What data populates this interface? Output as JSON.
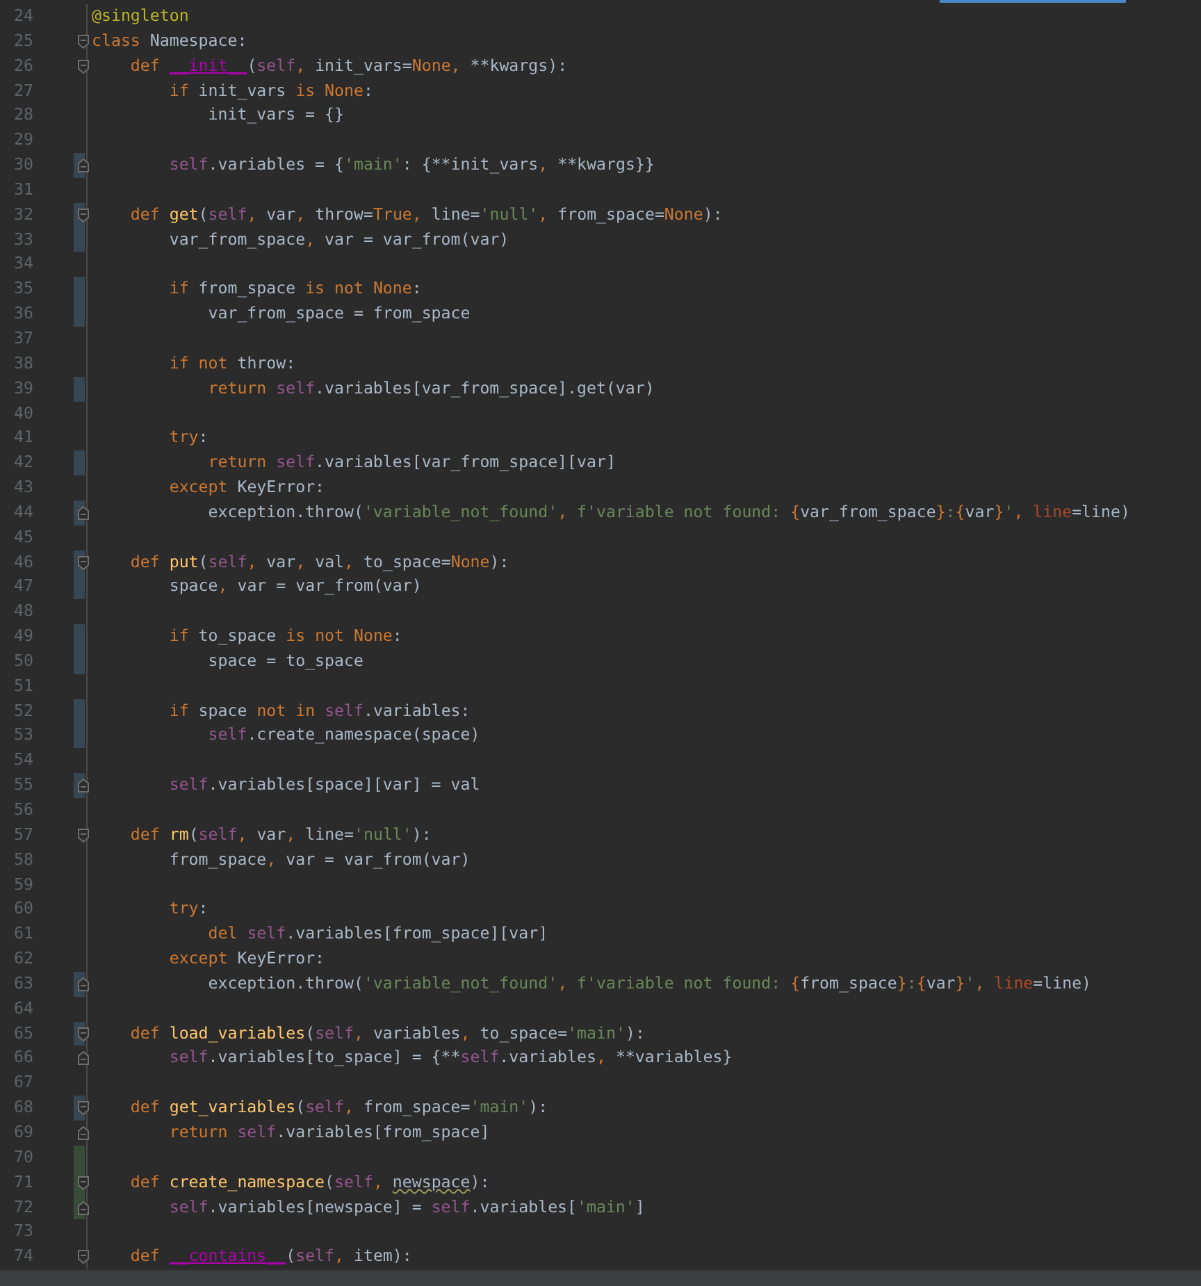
{
  "editor": {
    "lines": [
      {
        "number": "24",
        "fold_start": false,
        "fold_end": false,
        "modified": false,
        "added": false,
        "tokens": [
          {
            "kind": "decorator",
            "text": "@singleton"
          }
        ]
      },
      {
        "number": "25",
        "fold_start": true,
        "fold_end": false,
        "modified": false,
        "added": false,
        "tokens": [
          {
            "kind": "keyword",
            "text": "class"
          },
          {
            "kind": "plain",
            "text": " Namespace:"
          }
        ]
      },
      {
        "number": "26",
        "fold_start": true,
        "fold_end": false,
        "modified": false,
        "added": false,
        "tokens": [
          {
            "kind": "keyword",
            "text": "    def "
          },
          {
            "kind": "magic",
            "text": "__init__"
          },
          {
            "kind": "plain",
            "text": "("
          },
          {
            "kind": "self",
            "text": "self"
          },
          {
            "kind": "keyword",
            "text": ", "
          },
          {
            "kind": "plain",
            "text": "init_vars="
          },
          {
            "kind": "keyword",
            "text": "None"
          },
          {
            "kind": "keyword",
            "text": ", "
          },
          {
            "kind": "plain",
            "text": "**kwargs):"
          }
        ]
      },
      {
        "number": "27",
        "fold_start": false,
        "fold_end": false,
        "modified": false,
        "added": false,
        "tokens": [
          {
            "kind": "keyword",
            "text": "        if"
          },
          {
            "kind": "plain",
            "text": " init_vars "
          },
          {
            "kind": "keyword",
            "text": "is None"
          },
          {
            "kind": "plain",
            "text": ":"
          }
        ]
      },
      {
        "number": "28",
        "fold_start": false,
        "fold_end": false,
        "modified": false,
        "added": false,
        "tokens": [
          {
            "kind": "plain",
            "text": "            init_vars = {}"
          }
        ]
      },
      {
        "number": "29",
        "fold_start": false,
        "fold_end": false,
        "modified": false,
        "added": false
      },
      {
        "number": "30",
        "fold_start": false,
        "fold_end": true,
        "modified": true,
        "added": false,
        "tokens": [
          {
            "kind": "self",
            "text": "        self"
          },
          {
            "kind": "plain",
            "text": ".variables = {"
          },
          {
            "kind": "string",
            "text": "'main'"
          },
          {
            "kind": "plain",
            "text": ": {**init_vars"
          },
          {
            "kind": "keyword",
            "text": ", "
          },
          {
            "kind": "plain",
            "text": "**kwargs}}"
          }
        ]
      },
      {
        "number": "31",
        "fold_start": false,
        "fold_end": false,
        "modified": false,
        "added": false
      },
      {
        "number": "32",
        "fold_start": true,
        "fold_end": false,
        "modified": true,
        "added": false,
        "tokens": [
          {
            "kind": "keyword",
            "text": "    def "
          },
          {
            "kind": "function",
            "text": "get"
          },
          {
            "kind": "plain",
            "text": "("
          },
          {
            "kind": "self",
            "text": "self"
          },
          {
            "kind": "keyword",
            "text": ", "
          },
          {
            "kind": "plain",
            "text": "var"
          },
          {
            "kind": "keyword",
            "text": ", "
          },
          {
            "kind": "plain",
            "text": "throw="
          },
          {
            "kind": "keyword",
            "text": "True"
          },
          {
            "kind": "keyword",
            "text": ", "
          },
          {
            "kind": "plain",
            "text": "line="
          },
          {
            "kind": "string",
            "text": "'null'"
          },
          {
            "kind": "keyword",
            "text": ", "
          },
          {
            "kind": "plain",
            "text": "from_space="
          },
          {
            "kind": "keyword",
            "text": "None"
          },
          {
            "kind": "plain",
            "text": "):"
          }
        ]
      },
      {
        "number": "33",
        "fold_start": false,
        "fold_end": false,
        "modified": true,
        "added": false,
        "tokens": [
          {
            "kind": "plain",
            "text": "        var_from_space"
          },
          {
            "kind": "keyword",
            "text": ", "
          },
          {
            "kind": "plain",
            "text": "var = var_from(var)"
          }
        ]
      },
      {
        "number": "34",
        "fold_start": false,
        "fold_end": false,
        "modified": false,
        "added": false
      },
      {
        "number": "35",
        "fold_start": false,
        "fold_end": false,
        "modified": true,
        "added": false,
        "tokens": [
          {
            "kind": "keyword",
            "text": "        if"
          },
          {
            "kind": "plain",
            "text": " from_space "
          },
          {
            "kind": "keyword",
            "text": "is not None"
          },
          {
            "kind": "plain",
            "text": ":"
          }
        ]
      },
      {
        "number": "36",
        "fold_start": false,
        "fold_end": false,
        "modified": true,
        "added": false,
        "tokens": [
          {
            "kind": "plain",
            "text": "            var_from_space = from_space"
          }
        ]
      },
      {
        "number": "37",
        "fold_start": false,
        "fold_end": false,
        "modified": false,
        "added": false
      },
      {
        "number": "38",
        "fold_start": false,
        "fold_end": false,
        "modified": false,
        "added": false,
        "tokens": [
          {
            "kind": "keyword",
            "text": "        if not"
          },
          {
            "kind": "plain",
            "text": " throw:"
          }
        ]
      },
      {
        "number": "39",
        "fold_start": false,
        "fold_end": false,
        "modified": true,
        "added": false,
        "tokens": [
          {
            "kind": "keyword",
            "text": "            return "
          },
          {
            "kind": "self",
            "text": "self"
          },
          {
            "kind": "plain",
            "text": ".variables[var_from_space].get(var)"
          }
        ]
      },
      {
        "number": "40",
        "fold_start": false,
        "fold_end": false,
        "modified": false,
        "added": false
      },
      {
        "number": "41",
        "fold_start": false,
        "fold_end": false,
        "modified": false,
        "added": false,
        "tokens": [
          {
            "kind": "keyword",
            "text": "        try"
          },
          {
            "kind": "plain",
            "text": ":"
          }
        ]
      },
      {
        "number": "42",
        "fold_start": false,
        "fold_end": false,
        "modified": true,
        "added": false,
        "tokens": [
          {
            "kind": "keyword",
            "text": "            return "
          },
          {
            "kind": "self",
            "text": "self"
          },
          {
            "kind": "plain",
            "text": ".variables[var_from_space][var]"
          }
        ]
      },
      {
        "number": "43",
        "fold_start": false,
        "fold_end": false,
        "modified": false,
        "added": false,
        "tokens": [
          {
            "kind": "keyword",
            "text": "        except"
          },
          {
            "kind": "plain",
            "text": " KeyError:"
          }
        ]
      },
      {
        "number": "44",
        "fold_start": false,
        "fold_end": true,
        "modified": true,
        "added": false,
        "tokens": [
          {
            "kind": "plain",
            "text": "            exception.throw("
          },
          {
            "kind": "string",
            "text": "'variable_not_found'"
          },
          {
            "kind": "keyword",
            "text": ", "
          },
          {
            "kind": "string",
            "text": "f'variable not found: "
          },
          {
            "kind": "brace",
            "text": "{"
          },
          {
            "kind": "plain",
            "text": "var_from_space"
          },
          {
            "kind": "brace",
            "text": "}"
          },
          {
            "kind": "string",
            "text": ":"
          },
          {
            "kind": "brace",
            "text": "{"
          },
          {
            "kind": "plain",
            "text": "var"
          },
          {
            "kind": "brace",
            "text": "}"
          },
          {
            "kind": "string",
            "text": "'"
          },
          {
            "kind": "keyword",
            "text": ", "
          },
          {
            "kind": "kwarg",
            "text": "line"
          },
          {
            "kind": "plain",
            "text": "=line)"
          }
        ]
      },
      {
        "number": "45",
        "fold_start": false,
        "fold_end": false,
        "modified": false,
        "added": false
      },
      {
        "number": "46",
        "fold_start": true,
        "fold_end": false,
        "modified": true,
        "added": false,
        "tokens": [
          {
            "kind": "keyword",
            "text": "    def "
          },
          {
            "kind": "function",
            "text": "put"
          },
          {
            "kind": "plain",
            "text": "("
          },
          {
            "kind": "self",
            "text": "self"
          },
          {
            "kind": "keyword",
            "text": ", "
          },
          {
            "kind": "plain",
            "text": "var"
          },
          {
            "kind": "keyword",
            "text": ", "
          },
          {
            "kind": "plain",
            "text": "val"
          },
          {
            "kind": "keyword",
            "text": ", "
          },
          {
            "kind": "plain",
            "text": "to_space="
          },
          {
            "kind": "keyword",
            "text": "None"
          },
          {
            "kind": "plain",
            "text": "):"
          }
        ]
      },
      {
        "number": "47",
        "fold_start": false,
        "fold_end": false,
        "modified": true,
        "added": false,
        "tokens": [
          {
            "kind": "plain",
            "text": "        space"
          },
          {
            "kind": "keyword",
            "text": ", "
          },
          {
            "kind": "plain",
            "text": "var = var_from(var)"
          }
        ]
      },
      {
        "number": "48",
        "fold_start": false,
        "fold_end": false,
        "modified": false,
        "added": false
      },
      {
        "number": "49",
        "fold_start": false,
        "fold_end": false,
        "modified": true,
        "added": false,
        "tokens": [
          {
            "kind": "keyword",
            "text": "        if"
          },
          {
            "kind": "plain",
            "text": " to_space "
          },
          {
            "kind": "keyword",
            "text": "is not None"
          },
          {
            "kind": "plain",
            "text": ":"
          }
        ]
      },
      {
        "number": "50",
        "fold_start": false,
        "fold_end": false,
        "modified": true,
        "added": false,
        "tokens": [
          {
            "kind": "plain",
            "text": "            space = to_space"
          }
        ]
      },
      {
        "number": "51",
        "fold_start": false,
        "fold_end": false,
        "modified": false,
        "added": false
      },
      {
        "number": "52",
        "fold_start": false,
        "fold_end": false,
        "modified": true,
        "added": false,
        "tokens": [
          {
            "kind": "keyword",
            "text": "        if"
          },
          {
            "kind": "plain",
            "text": " space "
          },
          {
            "kind": "keyword",
            "text": "not in "
          },
          {
            "kind": "self",
            "text": "self"
          },
          {
            "kind": "plain",
            "text": ".variables:"
          }
        ]
      },
      {
        "number": "53",
        "fold_start": false,
        "fold_end": false,
        "modified": true,
        "added": false,
        "tokens": [
          {
            "kind": "self",
            "text": "            self"
          },
          {
            "kind": "plain",
            "text": ".create_namespace(space)"
          }
        ]
      },
      {
        "number": "54",
        "fold_start": false,
        "fold_end": false,
        "modified": false,
        "added": false
      },
      {
        "number": "55",
        "fold_start": false,
        "fold_end": true,
        "modified": true,
        "added": false,
        "tokens": [
          {
            "kind": "self",
            "text": "        self"
          },
          {
            "kind": "plain",
            "text": ".variables[space][var] = val"
          }
        ]
      },
      {
        "number": "56",
        "fold_start": false,
        "fold_end": false,
        "modified": false,
        "added": false
      },
      {
        "number": "57",
        "fold_start": true,
        "fold_end": false,
        "modified": false,
        "added": false,
        "tokens": [
          {
            "kind": "keyword",
            "text": "    def "
          },
          {
            "kind": "function",
            "text": "rm"
          },
          {
            "kind": "plain",
            "text": "("
          },
          {
            "kind": "self",
            "text": "self"
          },
          {
            "kind": "keyword",
            "text": ", "
          },
          {
            "kind": "plain",
            "text": "var"
          },
          {
            "kind": "keyword",
            "text": ", "
          },
          {
            "kind": "plain",
            "text": "line="
          },
          {
            "kind": "string",
            "text": "'null'"
          },
          {
            "kind": "plain",
            "text": "):"
          }
        ]
      },
      {
        "number": "58",
        "fold_start": false,
        "fold_end": false,
        "modified": false,
        "added": false,
        "tokens": [
          {
            "kind": "plain",
            "text": "        from_space"
          },
          {
            "kind": "keyword",
            "text": ", "
          },
          {
            "kind": "plain",
            "text": "var = var_from(var)"
          }
        ]
      },
      {
        "number": "59",
        "fold_start": false,
        "fold_end": false,
        "modified": false,
        "added": false
      },
      {
        "number": "60",
        "fold_start": false,
        "fold_end": false,
        "modified": false,
        "added": false,
        "tokens": [
          {
            "kind": "keyword",
            "text": "        try"
          },
          {
            "kind": "plain",
            "text": ":"
          }
        ]
      },
      {
        "number": "61",
        "fold_start": false,
        "fold_end": false,
        "modified": false,
        "added": false,
        "tokens": [
          {
            "kind": "keyword",
            "text": "            del "
          },
          {
            "kind": "self",
            "text": "self"
          },
          {
            "kind": "plain",
            "text": ".variables[from_space][var]"
          }
        ]
      },
      {
        "number": "62",
        "fold_start": false,
        "fold_end": false,
        "modified": false,
        "added": false,
        "tokens": [
          {
            "kind": "keyword",
            "text": "        except"
          },
          {
            "kind": "plain",
            "text": " KeyError:"
          }
        ]
      },
      {
        "number": "63",
        "fold_start": false,
        "fold_end": true,
        "modified": true,
        "added": false,
        "tokens": [
          {
            "kind": "plain",
            "text": "            exception.throw("
          },
          {
            "kind": "string",
            "text": "'variable_not_found'"
          },
          {
            "kind": "keyword",
            "text": ", "
          },
          {
            "kind": "string",
            "text": "f'variable not found: "
          },
          {
            "kind": "brace",
            "text": "{"
          },
          {
            "kind": "plain",
            "text": "from_space"
          },
          {
            "kind": "brace",
            "text": "}"
          },
          {
            "kind": "string",
            "text": ":"
          },
          {
            "kind": "brace",
            "text": "{"
          },
          {
            "kind": "plain",
            "text": "var"
          },
          {
            "kind": "brace",
            "text": "}"
          },
          {
            "kind": "string",
            "text": "'"
          },
          {
            "kind": "keyword",
            "text": ", "
          },
          {
            "kind": "kwarg",
            "text": "line"
          },
          {
            "kind": "plain",
            "text": "=line)"
          }
        ]
      },
      {
        "number": "64",
        "fold_start": false,
        "fold_end": false,
        "modified": false,
        "added": false
      },
      {
        "number": "65",
        "fold_start": true,
        "fold_end": false,
        "modified": true,
        "added": false,
        "tokens": [
          {
            "kind": "keyword",
            "text": "    def "
          },
          {
            "kind": "function",
            "text": "load_variables"
          },
          {
            "kind": "plain",
            "text": "("
          },
          {
            "kind": "self",
            "text": "self"
          },
          {
            "kind": "keyword",
            "text": ", "
          },
          {
            "kind": "plain",
            "text": "variables"
          },
          {
            "kind": "keyword",
            "text": ", "
          },
          {
            "kind": "plain",
            "text": "to_space="
          },
          {
            "kind": "string",
            "text": "'main'"
          },
          {
            "kind": "plain",
            "text": "):"
          }
        ]
      },
      {
        "number": "66",
        "fold_start": false,
        "fold_end": true,
        "modified": false,
        "added": false,
        "tokens": [
          {
            "kind": "self",
            "text": "        self"
          },
          {
            "kind": "plain",
            "text": ".variables[to_space] = {**"
          },
          {
            "kind": "self",
            "text": "self"
          },
          {
            "kind": "plain",
            "text": ".variables"
          },
          {
            "kind": "keyword",
            "text": ", "
          },
          {
            "kind": "plain",
            "text": "**variables}"
          }
        ]
      },
      {
        "number": "67",
        "fold_start": false,
        "fold_end": false,
        "modified": false,
        "added": false
      },
      {
        "number": "68",
        "fold_start": true,
        "fold_end": false,
        "modified": true,
        "added": false,
        "tokens": [
          {
            "kind": "keyword",
            "text": "    def "
          },
          {
            "kind": "function",
            "text": "get_variables"
          },
          {
            "kind": "plain",
            "text": "("
          },
          {
            "kind": "self",
            "text": "self"
          },
          {
            "kind": "keyword",
            "text": ", "
          },
          {
            "kind": "plain",
            "text": "from_space="
          },
          {
            "kind": "string",
            "text": "'main'"
          },
          {
            "kind": "plain",
            "text": "):"
          }
        ]
      },
      {
        "number": "69",
        "fold_start": false,
        "fold_end": true,
        "modified": false,
        "added": false,
        "tokens": [
          {
            "kind": "keyword",
            "text": "        return "
          },
          {
            "kind": "self",
            "text": "self"
          },
          {
            "kind": "plain",
            "text": ".variables[from_space]"
          }
        ]
      },
      {
        "number": "70",
        "fold_start": false,
        "fold_end": false,
        "modified": false,
        "added": true
      },
      {
        "number": "71",
        "fold_start": true,
        "fold_end": false,
        "modified": false,
        "added": true,
        "tokens": [
          {
            "kind": "keyword",
            "text": "    def "
          },
          {
            "kind": "function",
            "text": "create_namespace"
          },
          {
            "kind": "plain",
            "text": "("
          },
          {
            "kind": "self",
            "text": "self"
          },
          {
            "kind": "keyword",
            "text": ", "
          },
          {
            "kind": "warning",
            "text": "newspace"
          },
          {
            "kind": "plain",
            "text": "):"
          }
        ]
      },
      {
        "number": "72",
        "fold_start": false,
        "fold_end": true,
        "modified": false,
        "added": true,
        "tokens": [
          {
            "kind": "self",
            "text": "        self"
          },
          {
            "kind": "plain",
            "text": ".variables[newspace] = "
          },
          {
            "kind": "self",
            "text": "self"
          },
          {
            "kind": "plain",
            "text": ".variables["
          },
          {
            "kind": "string",
            "text": "'main'"
          },
          {
            "kind": "plain",
            "text": "]"
          }
        ]
      },
      {
        "number": "73",
        "fold_start": false,
        "fold_end": false,
        "modified": false,
        "added": false
      },
      {
        "number": "74",
        "fold_start": true,
        "fold_end": false,
        "modified": false,
        "added": false,
        "tokens": [
          {
            "kind": "keyword",
            "text": "    def "
          },
          {
            "kind": "magic",
            "text": "__contains__"
          },
          {
            "kind": "plain",
            "text": "("
          },
          {
            "kind": "self",
            "text": "self"
          },
          {
            "kind": "keyword",
            "text": ", "
          },
          {
            "kind": "plain",
            "text": "item):"
          }
        ]
      }
    ]
  }
}
